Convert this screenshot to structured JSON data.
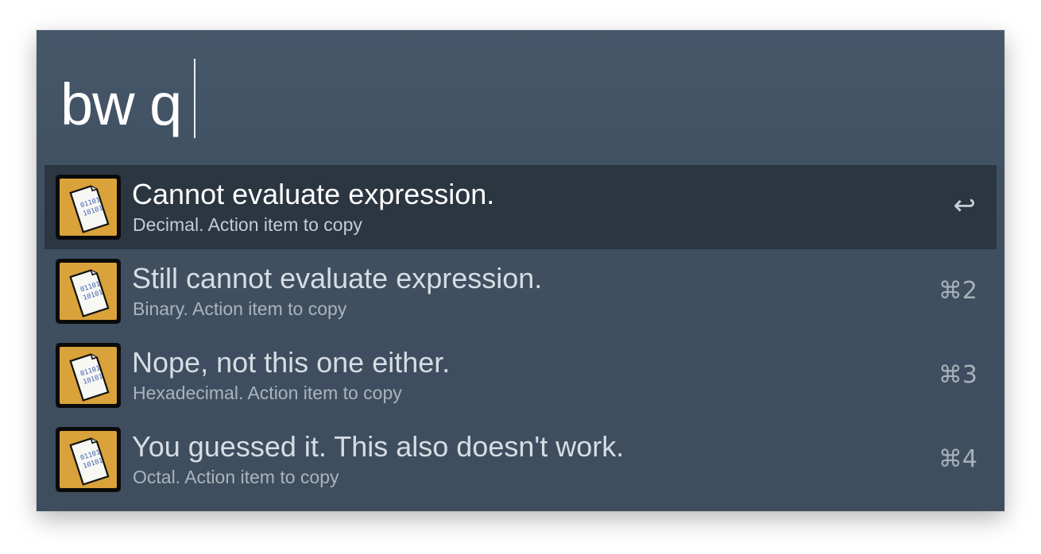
{
  "search": {
    "query": "bw q"
  },
  "results": [
    {
      "title": "Cannot evaluate expression.",
      "subtitle": "Decimal. Action item to copy",
      "shortcut": "↩",
      "icon": "binary-document-icon",
      "selected": true
    },
    {
      "title": "Still cannot evaluate expression.",
      "subtitle": "Binary. Action item to copy",
      "shortcut": "⌘2",
      "icon": "binary-document-icon",
      "selected": false
    },
    {
      "title": "Nope, not this one either.",
      "subtitle": "Hexadecimal. Action item to copy",
      "shortcut": "⌘3",
      "icon": "binary-document-icon",
      "selected": false
    },
    {
      "title": "You guessed it. This also doesn't work.",
      "subtitle": "Octal. Action item to copy",
      "shortcut": "⌘4",
      "icon": "binary-document-icon",
      "selected": false
    }
  ],
  "colors": {
    "window_background": "#3f4f60",
    "selected_row": "#2b3641",
    "icon_fill": "#d9a23a"
  }
}
